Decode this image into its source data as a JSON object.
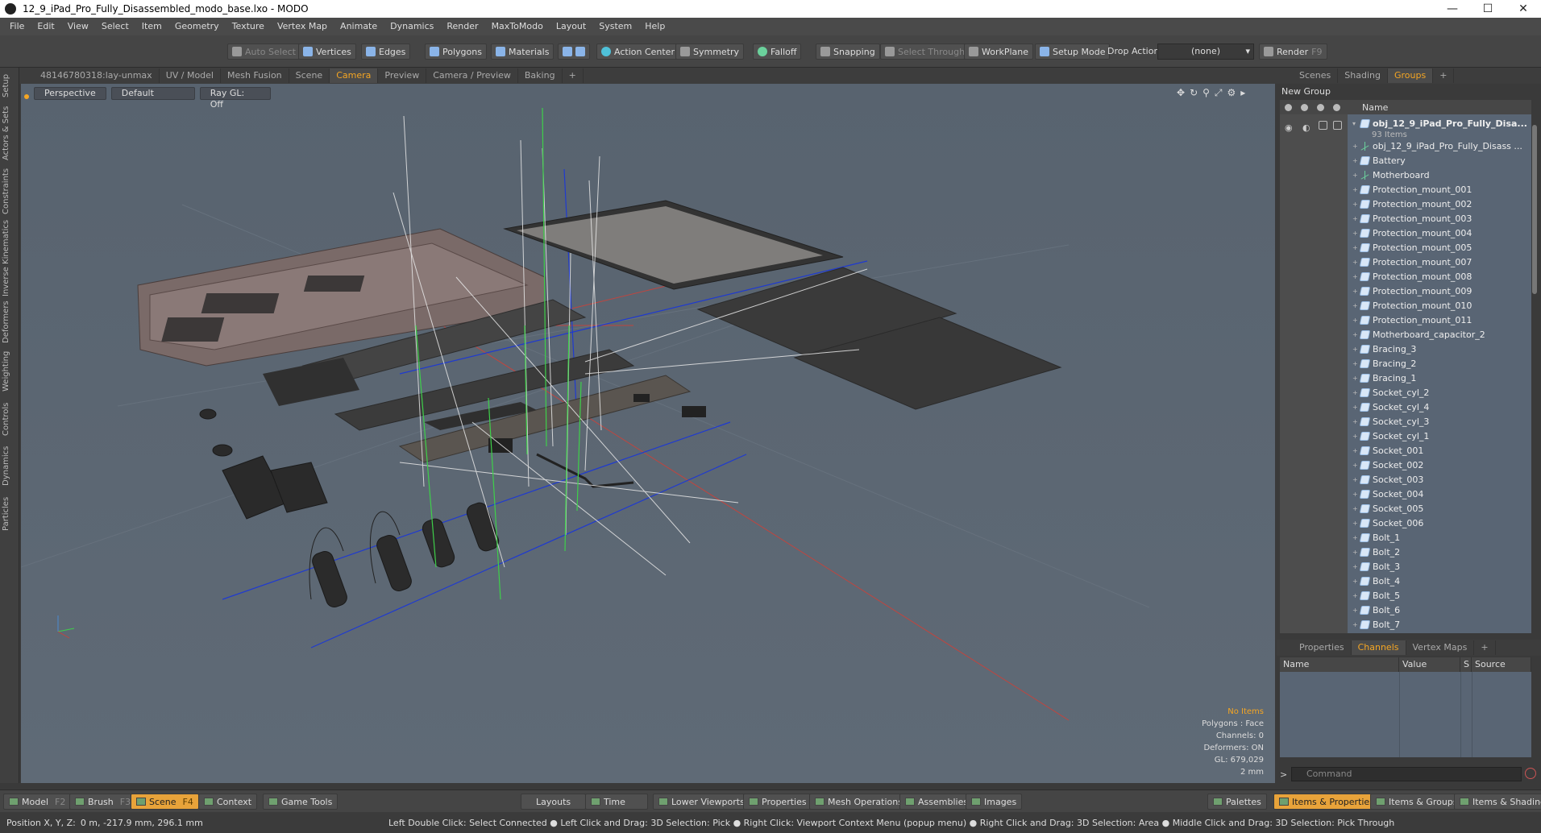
{
  "window": {
    "title": "12_9_iPad_Pro_Fully_Disassembled_modo_base.lxo - MODO"
  },
  "menu": [
    "File",
    "Edit",
    "View",
    "Select",
    "Item",
    "Geometry",
    "Texture",
    "Vertex Map",
    "Animate",
    "Dynamics",
    "Render",
    "MaxToModo",
    "Layout",
    "System",
    "Help"
  ],
  "toolbar": {
    "auto_select": "Auto Select",
    "vertices": "Vertices",
    "edges": "Edges",
    "polygons": "Polygons",
    "materials": "Materials",
    "action_center": "Action Center",
    "symmetry": "Symmetry",
    "falloff": "Falloff",
    "snapping": "Snapping",
    "select_through": "Select Through",
    "workplane": "WorkPlane",
    "setup_mode": "Setup Mode",
    "drop_action": "Drop Action",
    "drop_value": "(none)",
    "render": "Render",
    "render_key": "F9"
  },
  "left_tabs": [
    "Setup",
    "Actors & Sets",
    "Constraints",
    "Inverse Kinematics",
    "Deformers",
    "Weighting",
    "Controls",
    "Dynamics",
    "Particles"
  ],
  "viewport_tabs": [
    "48146780318:lay-unmax",
    "UV / Model",
    "Mesh Fusion",
    "Scene",
    "Camera",
    "Preview",
    "Camera / Preview",
    "Baking",
    "+"
  ],
  "viewport_header": {
    "view": "Perspective",
    "shading": "Default",
    "raygl": "Ray GL: Off"
  },
  "viewport_info": {
    "items": "No Items",
    "polygons": "Polygons : Face",
    "channels": "Channels: 0",
    "deformers": "Deformers: ON",
    "gl": "GL: 679,029",
    "scale": "2 mm"
  },
  "right_tabs": [
    "Scenes",
    "Shading",
    "Groups",
    "+"
  ],
  "groups": {
    "new_group": "New Group",
    "header_name": "Name",
    "root": "obj_12_9_iPad_Pro_Fully_Disa...",
    "root_count": "93 Items",
    "items": [
      {
        "label": "obj_12_9_iPad_Pro_Fully_Disass ...",
        "icon": "locator"
      },
      {
        "label": "Battery",
        "icon": "mesh"
      },
      {
        "label": "Motherboard",
        "icon": "locator"
      },
      {
        "label": "Protection_mount_001",
        "icon": "mesh"
      },
      {
        "label": "Protection_mount_002",
        "icon": "mesh"
      },
      {
        "label": "Protection_mount_003",
        "icon": "mesh"
      },
      {
        "label": "Protection_mount_004",
        "icon": "mesh"
      },
      {
        "label": "Protection_mount_005",
        "icon": "mesh"
      },
      {
        "label": "Protection_mount_007",
        "icon": "mesh"
      },
      {
        "label": "Protection_mount_008",
        "icon": "mesh"
      },
      {
        "label": "Protection_mount_009",
        "icon": "mesh"
      },
      {
        "label": "Protection_mount_010",
        "icon": "mesh"
      },
      {
        "label": "Protection_mount_011",
        "icon": "mesh"
      },
      {
        "label": "Motherboard_capacitor_2",
        "icon": "mesh"
      },
      {
        "label": "Bracing_3",
        "icon": "mesh"
      },
      {
        "label": "Bracing_2",
        "icon": "mesh"
      },
      {
        "label": "Bracing_1",
        "icon": "mesh"
      },
      {
        "label": "Socket_cyl_2",
        "icon": "mesh"
      },
      {
        "label": "Socket_cyl_4",
        "icon": "mesh"
      },
      {
        "label": "Socket_cyl_3",
        "icon": "mesh"
      },
      {
        "label": "Socket_cyl_1",
        "icon": "mesh"
      },
      {
        "label": "Socket_001",
        "icon": "mesh"
      },
      {
        "label": "Socket_002",
        "icon": "mesh"
      },
      {
        "label": "Socket_003",
        "icon": "mesh"
      },
      {
        "label": "Socket_004",
        "icon": "mesh"
      },
      {
        "label": "Socket_005",
        "icon": "mesh"
      },
      {
        "label": "Socket_006",
        "icon": "mesh"
      },
      {
        "label": "Bolt_1",
        "icon": "mesh"
      },
      {
        "label": "Bolt_2",
        "icon": "mesh"
      },
      {
        "label": "Bolt_3",
        "icon": "mesh"
      },
      {
        "label": "Bolt_4",
        "icon": "mesh"
      },
      {
        "label": "Bolt_5",
        "icon": "mesh"
      },
      {
        "label": "Bolt_6",
        "icon": "mesh"
      },
      {
        "label": "Bolt_7",
        "icon": "mesh"
      }
    ]
  },
  "properties_tabs": [
    "Properties",
    "Channels",
    "Vertex Maps",
    "+"
  ],
  "channels_header": {
    "name": "Name",
    "value": "Value",
    "s": "S",
    "source": "Source"
  },
  "command": {
    "prompt": ">",
    "placeholder": "Command"
  },
  "bottom": {
    "model": "Model",
    "model_key": "F2",
    "brush": "Brush",
    "brush_key": "F3",
    "scene": "Scene",
    "scene_key": "F4",
    "context": "Context",
    "game_tools": "Game Tools",
    "layouts": "Layouts",
    "time": "Time",
    "lower_viewports": "Lower Viewports",
    "properties": "Properties",
    "mesh_operations": "Mesh Operations",
    "assemblies": "Assemblies",
    "images": "Images",
    "palettes": "Palettes",
    "items_properties": "Items & Properties",
    "items_groups": "Items & Groups",
    "items_shading": "Items & Shading"
  },
  "status": {
    "position_label": "Position X, Y, Z:",
    "position_value": "0 m, -217.9 mm, 296.1 mm",
    "hint": "Left Double Click: Select Connected ● Left Click and Drag: 3D Selection: Pick ● Right Click: Viewport Context Menu (popup menu) ● Right Click and Drag: 3D Selection: Area ● Middle Click and Drag: 3D Selection: Pick Through"
  },
  "colors": {
    "accent": "#f5a623",
    "viewport_bg": "#5b6674"
  }
}
